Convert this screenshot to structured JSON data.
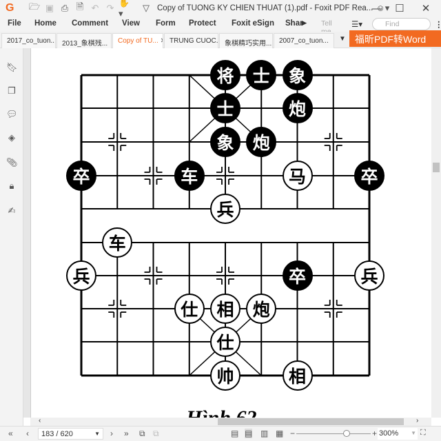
{
  "titlebar": {
    "title": "Copy of TUONG KY CHIEN THUAT (1).pdf - Foxit PDF Rea...",
    "icons": [
      "foxit-logo",
      "open-icon",
      "save-icon",
      "print-icon",
      "properties-icon",
      "undo-icon",
      "redo-icon",
      "hand-tool-icon",
      "customize-icon",
      "account-icon"
    ]
  },
  "menu": {
    "items": [
      "File",
      "Home",
      "Comment",
      "View",
      "Form",
      "Protect",
      "Foxit eSign",
      "Shar"
    ],
    "tell_me_placeholder": "Tell me...",
    "find_placeholder": "Find"
  },
  "tabs": [
    {
      "label": "2017_co_tuon..."
    },
    {
      "label": "2013_象棋残..."
    },
    {
      "label": "Copy of TU...",
      "active": true
    },
    {
      "label": "TRUNG CUOC..."
    },
    {
      "label": "象棋精巧实用..."
    },
    {
      "label": "2007_co_tuon..."
    }
  ],
  "promo": "福昕PDF转Word",
  "sidebar": [
    "bookmark-icon",
    "pages-icon",
    "comment-icon",
    "layers-icon",
    "attachment-icon",
    "security-icon",
    "signature-icon"
  ],
  "board": {
    "pieces": [
      {
        "char": "将",
        "color": "black",
        "col": 4,
        "row": 0
      },
      {
        "char": "士",
        "color": "black",
        "col": 5,
        "row": 0
      },
      {
        "char": "象",
        "color": "black",
        "col": 6,
        "row": 0
      },
      {
        "char": "士",
        "color": "black",
        "col": 4,
        "row": 1
      },
      {
        "char": "炮",
        "color": "black",
        "col": 6,
        "row": 1
      },
      {
        "char": "象",
        "color": "black",
        "col": 4,
        "row": 2
      },
      {
        "char": "炮",
        "color": "black",
        "col": 5,
        "row": 2
      },
      {
        "char": "卒",
        "color": "black",
        "col": 0,
        "row": 3
      },
      {
        "char": "车",
        "color": "black",
        "col": 3,
        "row": 3
      },
      {
        "char": "马",
        "color": "white",
        "col": 6,
        "row": 3
      },
      {
        "char": "卒",
        "color": "black",
        "col": 8,
        "row": 3
      },
      {
        "char": "兵",
        "color": "white",
        "col": 4,
        "row": 4
      },
      {
        "char": "车",
        "color": "white",
        "col": 1,
        "row": 5
      },
      {
        "char": "兵",
        "color": "white",
        "col": 0,
        "row": 6
      },
      {
        "char": "卒",
        "color": "black",
        "col": 6,
        "row": 6
      },
      {
        "char": "兵",
        "color": "white",
        "col": 8,
        "row": 6
      },
      {
        "char": "仕",
        "color": "white",
        "col": 3,
        "row": 7
      },
      {
        "char": "相",
        "color": "white",
        "col": 4,
        "row": 7
      },
      {
        "char": "炮",
        "color": "white",
        "col": 5,
        "row": 7
      },
      {
        "char": "仕",
        "color": "white",
        "col": 4,
        "row": 8
      },
      {
        "char": "帅",
        "color": "white",
        "col": 4,
        "row": 9
      },
      {
        "char": "相",
        "color": "white",
        "col": 6,
        "row": 9
      }
    ],
    "caption": "Hình 62"
  },
  "status": {
    "page": "183 / 620",
    "zoom": "300%",
    "zoom_level_percent": 300
  }
}
